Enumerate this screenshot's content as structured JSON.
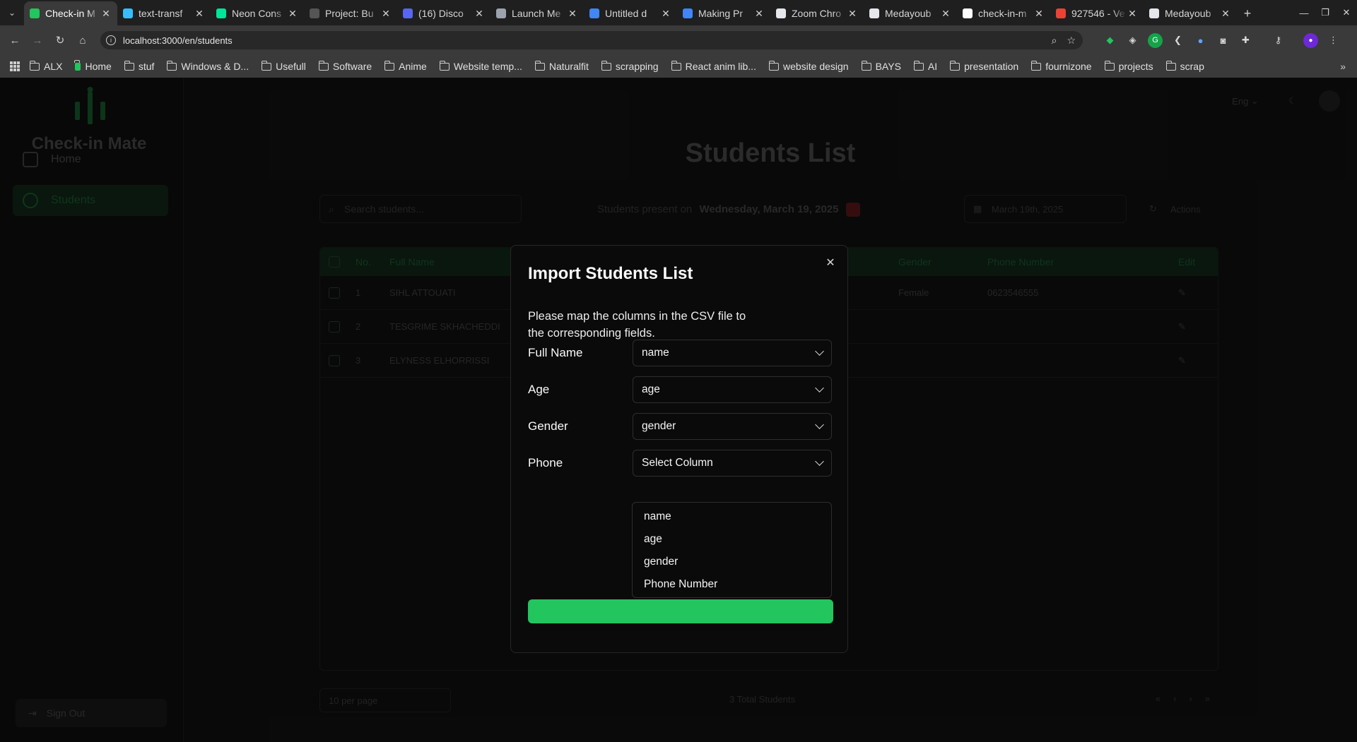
{
  "browser": {
    "tabs": [
      {
        "label": "Check-in M",
        "icon_color": "#22c55e",
        "active": true
      },
      {
        "label": "text-transf",
        "icon_color": "#38bdf8"
      },
      {
        "label": "Neon Cons",
        "icon_color": "#00e599"
      },
      {
        "label": "Project: Bu",
        "icon_color": "#555555"
      },
      {
        "label": "(16) Disco",
        "icon_color": "#5865f2"
      },
      {
        "label": "Launch Me",
        "icon_color": "#9ca3af"
      },
      {
        "label": "Untitled d",
        "icon_color": "#4285f4"
      },
      {
        "label": "Making Pr",
        "icon_color": "#4285f4"
      },
      {
        "label": "Zoom Chro",
        "icon_color": "#e5e7eb"
      },
      {
        "label": "Medayoub",
        "icon_color": "#e5e7eb"
      },
      {
        "label": "check-in-m",
        "icon_color": "#ffffff"
      },
      {
        "label": "927546 - Ve",
        "icon_color": "#ea4335"
      },
      {
        "label": "Medayoub",
        "icon_color": "#e5e7eb"
      }
    ],
    "url": "localhost:3000/en/students",
    "bookmarks": [
      "ALX",
      "Home",
      "stuf",
      "Windows & D...",
      "Usefull",
      "Software",
      "Anime",
      "Website temp...",
      "Naturalfit",
      "scrapping",
      "React anim lib...",
      "website design",
      "BAYS",
      "AI",
      "presentation",
      "fournizone",
      "projects",
      "scrap"
    ]
  },
  "sidebar": {
    "app_name": "Check-in Mate",
    "items": [
      {
        "label": "Home",
        "active": false
      },
      {
        "label": "Students",
        "active": true
      }
    ],
    "signout_label": "Sign Out"
  },
  "header": {
    "language_label": "Eng"
  },
  "page": {
    "title": "Students List",
    "search_placeholder": "Search students...",
    "present_label": "Students present on",
    "present_date": "Wednesday, March 19, 2025",
    "date_picker_value": "March 19th, 2025",
    "actions_label": "Actions",
    "table": {
      "columns": [
        "No.",
        "Full Name",
        "Gender",
        "Phone Number",
        "Edit"
      ],
      "rows": [
        {
          "no": "1",
          "name": "SIHL ATTOUATI",
          "gender": "Female",
          "phone": "0623546555"
        },
        {
          "no": "2",
          "name": "TESGRIME SKHACHEDDI",
          "gender": "",
          "phone": ""
        },
        {
          "no": "3",
          "name": "ELYNESS ELHORRISSI",
          "gender": "",
          "phone": ""
        }
      ]
    },
    "per_page_label": "10 per page",
    "total_label": "3 Total Students"
  },
  "modal": {
    "title": "Import Students List",
    "description": "Please map the columns in the CSV file to the corresponding fields.",
    "fields": [
      {
        "label": "Full Name",
        "value": "name"
      },
      {
        "label": "Age",
        "value": "age"
      },
      {
        "label": "Gender",
        "value": "gender"
      },
      {
        "label": "Phone",
        "value": "Select Column"
      }
    ],
    "dropdown_options": [
      "name",
      "age",
      "gender",
      "Phone Number"
    ],
    "accent_color": "#22c55e"
  }
}
